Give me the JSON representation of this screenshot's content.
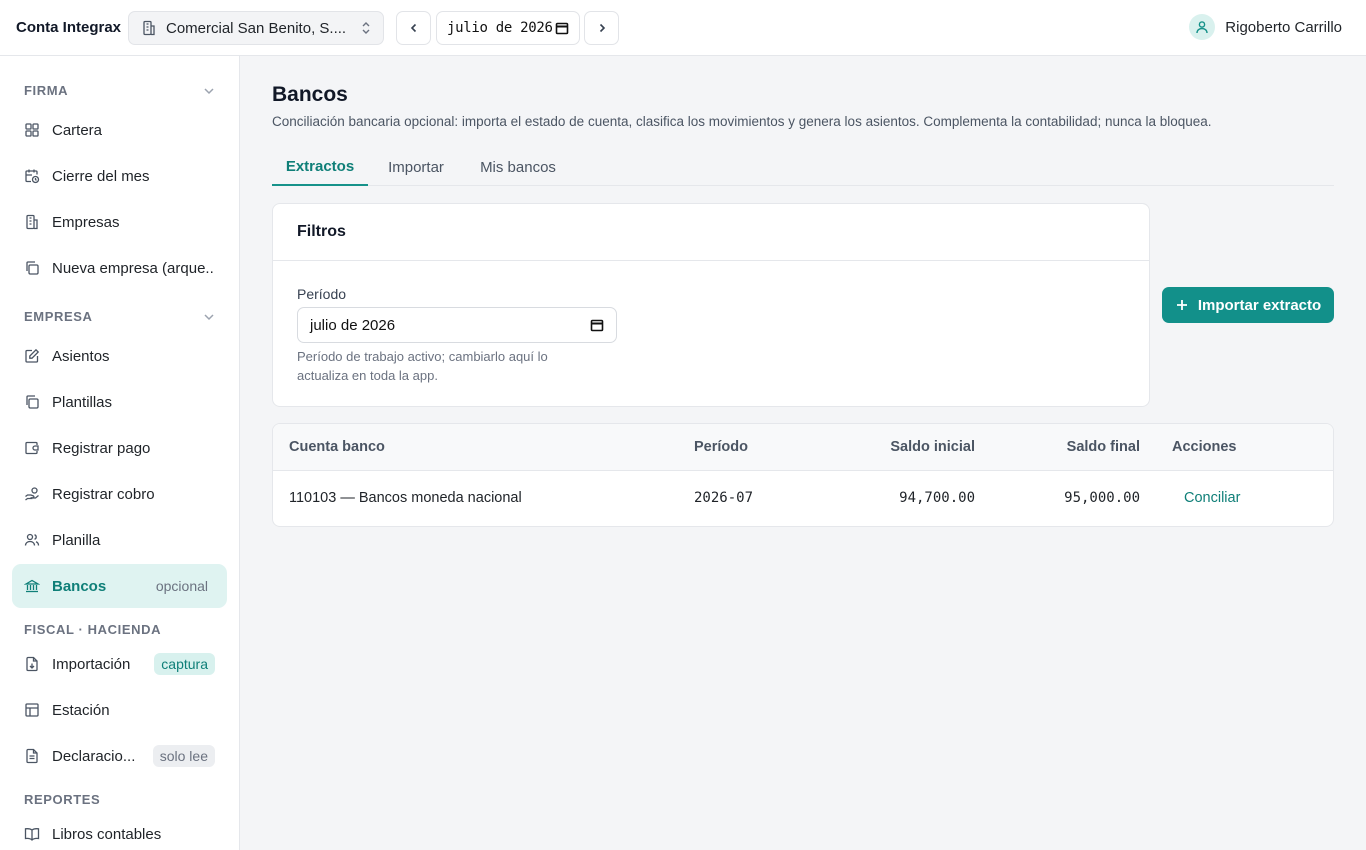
{
  "topbar": {
    "brand": "Conta Integrax",
    "company": "Comercial San Benito, S....",
    "period": "julio de 2026",
    "user_name": "Rigoberto Carrillo"
  },
  "sidebar": {
    "sections": [
      {
        "title": "FIRMA",
        "collapsible": true,
        "items": [
          {
            "label": "Cartera",
            "icon": "grid-icon"
          },
          {
            "label": "Cierre del mes",
            "icon": "calendar-clock-icon"
          },
          {
            "label": "Empresas",
            "icon": "building-icon"
          },
          {
            "label": "Nueva empresa (arque...",
            "icon": "copy-icon"
          }
        ]
      },
      {
        "title": "EMPRESA",
        "collapsible": true,
        "items": [
          {
            "label": "Asientos",
            "icon": "edit-icon"
          },
          {
            "label": "Plantillas",
            "icon": "copy-icon"
          },
          {
            "label": "Registrar pago",
            "icon": "wallet-icon"
          },
          {
            "label": "Registrar cobro",
            "icon": "hand-coins-icon"
          },
          {
            "label": "Planilla",
            "icon": "users-icon"
          },
          {
            "label": "Bancos",
            "icon": "bank-icon",
            "badge": "opcional",
            "active": true
          }
        ]
      },
      {
        "title": "FISCAL · HACIENDA",
        "collapsible": false,
        "items": [
          {
            "label": "Importación",
            "icon": "file-import-icon",
            "badge": "captura"
          },
          {
            "label": "Estación",
            "icon": "table-icon"
          },
          {
            "label": "Declaracio...",
            "icon": "file-text-icon",
            "badge": "solo lee"
          }
        ]
      },
      {
        "title": "REPORTES",
        "collapsible": false,
        "items": [
          {
            "label": "Libros contables",
            "icon": "book-open-icon"
          }
        ]
      }
    ]
  },
  "main": {
    "title": "Bancos",
    "description": "Conciliación bancaria opcional: importa el estado de cuenta, clasifica los movimientos y genera los asientos. Complementa la contabilidad; nunca la bloquea.",
    "tabs": [
      {
        "label": "Extractos",
        "active": true
      },
      {
        "label": "Importar",
        "active": false
      },
      {
        "label": "Mis bancos",
        "active": false
      }
    ],
    "filters": {
      "title": "Filtros",
      "period_label": "Período",
      "period_value": "julio de 2026",
      "period_hint": "Período de trabajo activo; cambiarlo aquí lo actualiza en toda la app."
    },
    "import_button": "Importar extracto",
    "table": {
      "columns": [
        "Cuenta banco",
        "Período",
        "Saldo inicial",
        "Saldo final",
        "Acciones"
      ],
      "rows": [
        {
          "account": "110103 — Bancos moneda nacional",
          "period": "2026-07",
          "opening": "94,700.00",
          "closing": "95,000.00",
          "action": "Conciliar"
        }
      ]
    }
  },
  "colors": {
    "accent": "#12908a",
    "accent_text": "#0f7f78",
    "active_bg": "#dff3f1"
  }
}
